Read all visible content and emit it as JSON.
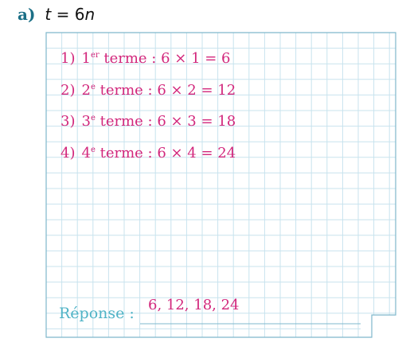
{
  "exercise": {
    "part_label": "a)",
    "expression_var": "t",
    "expression_eq": " = 6",
    "expression_n": "n"
  },
  "items": [
    {
      "num": "1)",
      "ordinal": "1",
      "suffix": "er",
      "word": " terme",
      "colon": " : ",
      "calc": "6 × 1 = 6"
    },
    {
      "num": "2)",
      "ordinal": "2",
      "suffix": "e",
      "word": " terme",
      "colon": " : ",
      "calc": "6 × 2 = 12"
    },
    {
      "num": "3)",
      "ordinal": "3",
      "suffix": "e",
      "word": " terme",
      "colon": " : ",
      "calc": "6 × 3 = 18"
    },
    {
      "num": "4)",
      "ordinal": "4",
      "suffix": "e",
      "word": " terme",
      "colon": " : ",
      "calc": "6 × 4 = 24"
    }
  ],
  "response": {
    "label": "Réponse :",
    "value": "6, 12, 18, 24"
  },
  "colors": {
    "grid_line": "#c8e3ee",
    "grid_border": "#7fb8cc",
    "handwriting": "#d2277c",
    "label": "#4fb3c6",
    "title": "#1b6f86"
  }
}
